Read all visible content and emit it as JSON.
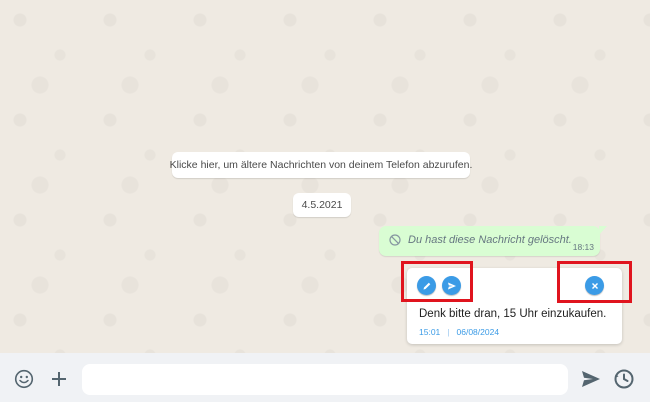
{
  "chat": {
    "system_message": "Klicke hier, um ältere Nachrichten von deinem Telefon abzurufen.",
    "date_divider": "4.5.2021",
    "deleted_message": {
      "text": "Du hast diese Nachricht gelöscht.",
      "time": "18:13"
    },
    "draft": {
      "text": "Denk bitte dran, 15 Uhr einzukaufen.",
      "time": "15:01",
      "date": "06/08/2024",
      "separator": "|",
      "edit_icon": "pencil-icon",
      "send_icon": "send-icon",
      "cancel_icon": "close-icon"
    }
  },
  "composer": {
    "emoji_icon": "emoji-icon",
    "attach_icon": "plus-icon",
    "input_value": "",
    "input_placeholder": "",
    "send_icon": "send-arrow-icon",
    "schedule_icon": "clock-icon"
  },
  "colors": {
    "chat_background": "#efeae2",
    "outgoing_bubble": "#d9fdd3",
    "accent_blue": "#3b9be6",
    "highlight_red": "#e0141e",
    "composer_background": "#f0f2f5"
  }
}
